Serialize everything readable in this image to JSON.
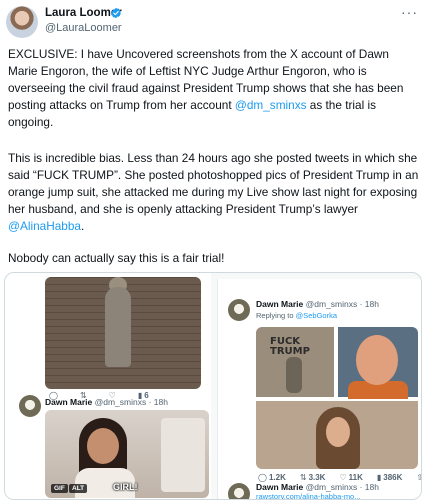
{
  "author": {
    "name": "Laura Loomer",
    "handle": "@LauraLoomer"
  },
  "tweet": {
    "p1_a": "EXCLUSIVE: I have Uncovered screenshots from the X account of Dawn Marie Engoron, the wife of Leftist NYC Judge Arthur Engoron, who is overseeing the civil fraud  against President Trump shows that she has been posting attacks on Trump from her account ",
    "p1_mention": "@dm_sminxs",
    "p1_b": " as the trial is ongoing.",
    "p2_a": "This is incredible bias. Less than 24 hours ago she posted tweets in which she said “FUCK TRUMP”. She posted photoshopped pics of President Trump in an orange jump suit, she attacked me during my Live show last night for exposing her husband, and she is openly  attacking President Trump’s lawyer ",
    "p2_mention": "@AlinaHabba",
    "p2_b": ".",
    "p3": "Nobody can actually say this is a fair trial!"
  },
  "left_card": {
    "actions_top": [
      "",
      "",
      "",
      "6"
    ],
    "post": {
      "name": "Dawn Marie",
      "handle": "@dm_sminxs · 18h"
    },
    "badges": [
      "GIF",
      "ALT"
    ],
    "caption": "GIRL!"
  },
  "right_card": {
    "post1": {
      "name": "Dawn Marie",
      "handle": "@dm_sminxs · 18h",
      "reply_prefix": "Replying to ",
      "reply_mention": "@SebGorka"
    },
    "image_text": [
      "FUCK",
      "TRUMP"
    ],
    "actions": [
      "1.2K",
      "3.3K",
      "11K",
      "386K",
      ""
    ],
    "post2": {
      "name": "Dawn Marie",
      "handle": "@dm_sminxs · 18h",
      "link": "rawstory.com/alina-habba-mo..."
    }
  },
  "colors": {
    "accent": "#1d9bf0",
    "text": "#0f1419",
    "muted": "#536471",
    "border": "#cfd9de"
  }
}
